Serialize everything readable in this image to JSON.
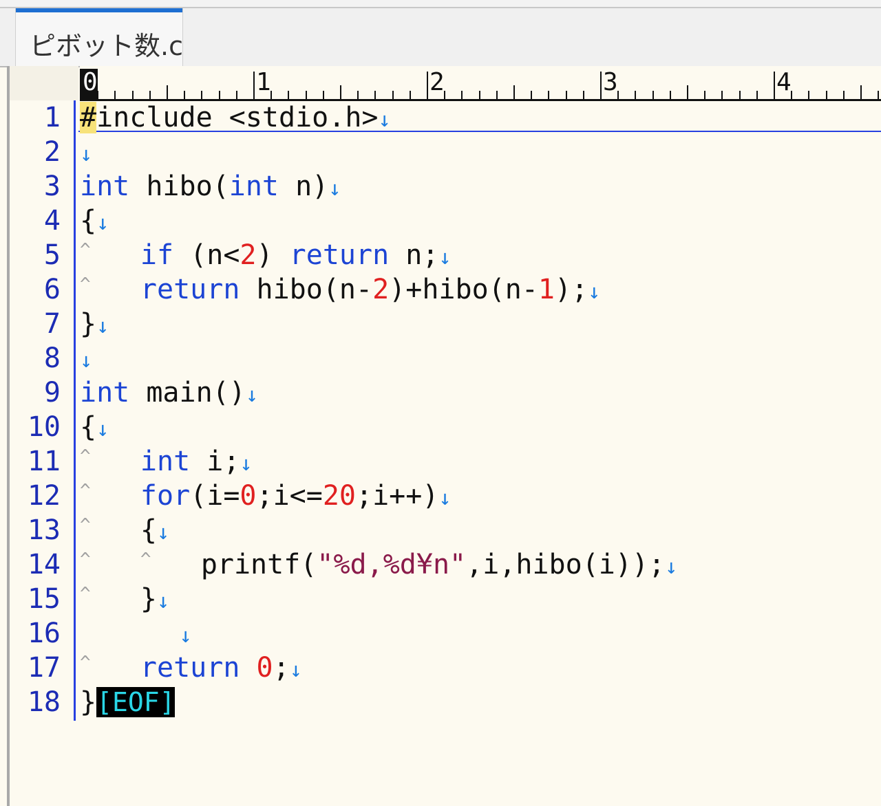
{
  "tab": {
    "title": "ピボット数.c"
  },
  "ruler": {
    "labels": [
      "0",
      "1",
      "2",
      "3",
      "4"
    ]
  },
  "markers": {
    "newline": "↓",
    "tab": "^",
    "eof": "[EOF]"
  },
  "line_numbers": [
    "1",
    "2",
    "3",
    "4",
    "5",
    "6",
    "7",
    "8",
    "9",
    "10",
    "11",
    "12",
    "13",
    "14",
    "15",
    "16",
    "17",
    "18"
  ],
  "code": {
    "l1_a": "#",
    "l1_b": "include <stdio.h>",
    "l3_int": "int",
    "l3_b": " hibo(",
    "l3_int2": "int",
    "l3_c": " n)",
    "l4": "{",
    "l5_if": "if",
    "l5_b": " (n<",
    "l5_num": "2",
    "l5_c": ") ",
    "l5_ret": "return",
    "l5_d": " n;",
    "l6_ret": "return",
    "l6_b": " hibo(n-",
    "l6_num1": "2",
    "l6_c": ")+hibo(n-",
    "l6_num2": "1",
    "l6_d": ");",
    "l7": "}",
    "l9_int": "int",
    "l9_b": " main()",
    "l10": "{",
    "l11_int": "int",
    "l11_b": " i;",
    "l12_for": "for",
    "l12_b": "(i=",
    "l12_n1": "0",
    "l12_c": ";i<=",
    "l12_n2": "20",
    "l12_d": ";i++)",
    "l13": "{",
    "l14_a": "printf(",
    "l14_str": "\"%d,%d¥n\"",
    "l14_b": ",i,hibo(i));",
    "l15": "}",
    "l17_ret": "return",
    "l17_num": "0",
    "l17_b": ";",
    "l18": "}"
  }
}
